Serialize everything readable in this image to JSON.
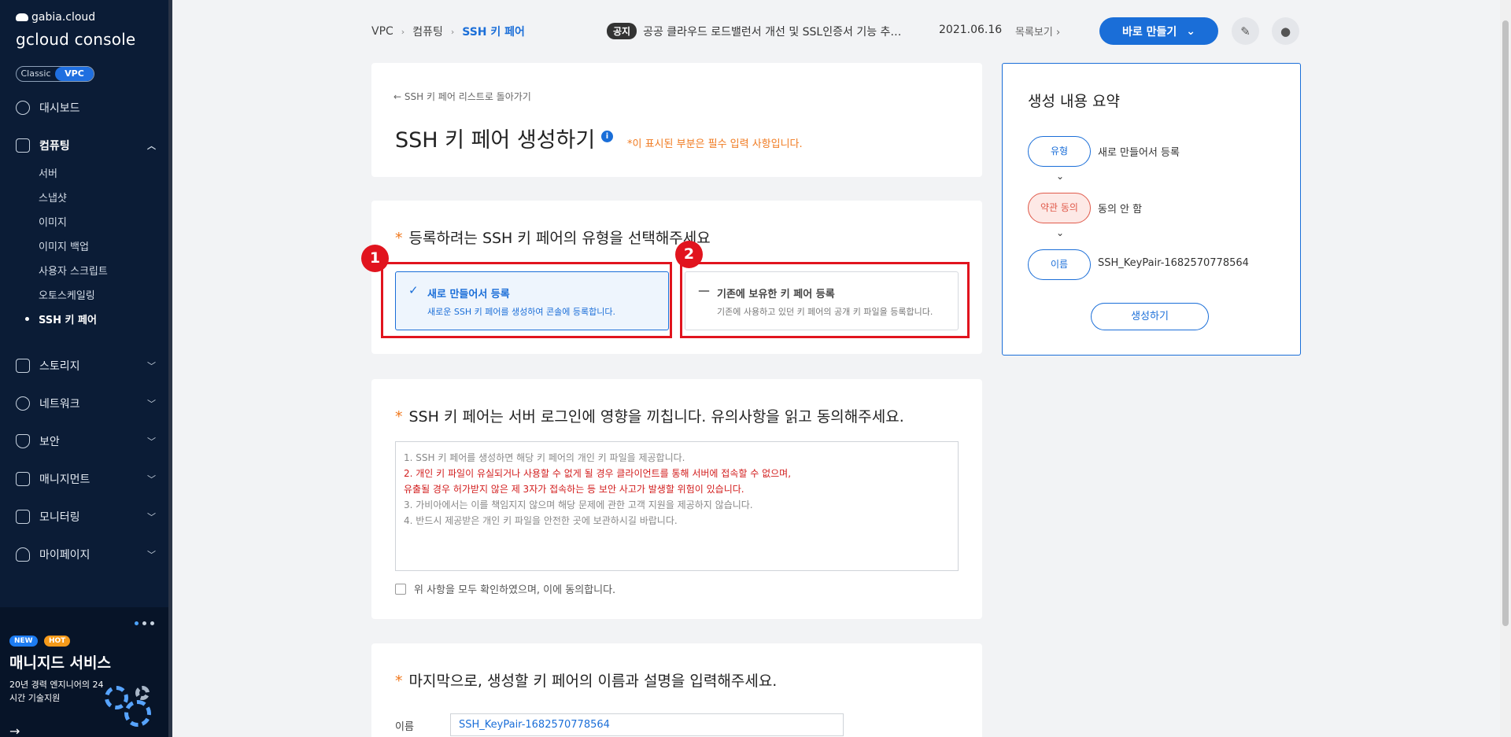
{
  "sidebar": {
    "logo_top": "gabia.cloud",
    "logo_main": "gcloud console",
    "mode": {
      "classic": "Classic",
      "vpc": "VPC"
    },
    "items": [
      {
        "label": "대시보드"
      },
      {
        "label": "컴퓨팅",
        "expanded": true
      },
      {
        "label": "스토리지"
      },
      {
        "label": "네트워크"
      },
      {
        "label": "보안"
      },
      {
        "label": "매니지먼트"
      },
      {
        "label": "모니터링"
      },
      {
        "label": "마이페이지"
      }
    ],
    "sub_items": [
      "서버",
      "스냅샷",
      "이미지",
      "이미지 백업",
      "사용자 스크립트",
      "오토스케일링",
      "SSH 키 페어"
    ],
    "promo": {
      "badge_new": "NEW",
      "badge_hot": "HOT",
      "title": "매니지드 서비스",
      "subtitle": "20년 경력 엔지니어의 24시간 기술지원"
    }
  },
  "topbar": {
    "breadcrumb": [
      "VPC",
      "컴퓨팅",
      "SSH 키 페어"
    ],
    "notice_tag": "공지",
    "notice_text": "공공 클라우드 로드밸런서 개선 및 SSL인증서 기능 추…",
    "notice_date": "2021.06.16",
    "notice_more": "목록보기",
    "make_button": "바로 만들기"
  },
  "header": {
    "back_link": "SSH 키 페어 리스트로 돌아가기",
    "title": "SSH 키 페어 생성하기",
    "required_note": "*이 표시된 부분은 필수 입력 사항입니다."
  },
  "type_section": {
    "title": "등록하려는 SSH 키 페어의 유형을 선택해주세요",
    "options": [
      {
        "title": "새로 만들어서 등록",
        "desc": "새로운 SSH 키 페어를 생성하여 콘솔에 등록합니다.",
        "selected": true,
        "marker": "1"
      },
      {
        "title": "기존에 보유한 키 페어 등록",
        "desc": "기존에 사용하고 있던 키 페어의 공개 키 파일을 등록합니다.",
        "selected": false,
        "marker": "2"
      }
    ]
  },
  "terms_section": {
    "title": "SSH 키 페어는 서버 로그인에 영향을 끼칩니다. 유의사항을 읽고 동의해주세요.",
    "lines": [
      "1. SSH 키 페어를 생성하면 해당 키 페어의 개인 키 파일을 제공합니다.",
      "2. 개인 키 파일이 유실되거나 사용할 수 없게 될 경우 클라이언트를 통해 서버에 접속할 수 없으며,",
      "유출될 경우 허가받지 않은 제 3자가 접속하는 등 보안 사고가 발생할 위험이 있습니다.",
      "3. 가비아에서는 이를 책임지지 않으며 해당 문제에 관한 고객 지원을 제공하지 않습니다.",
      "4. 반드시 제공받은 개인 키 파일을 안전한 곳에 보관하시길 바랍니다."
    ],
    "agree_label": "위 사항을 모두 확인하였으며, 이에 동의합니다."
  },
  "name_section": {
    "title": "마지막으로, 생성할 키 페어의 이름과 설명을 입력해주세요.",
    "name_label": "이름",
    "name_value": "SSH_KeyPair-1682570778564"
  },
  "summary": {
    "title": "생성 내용 요약",
    "rows": [
      {
        "pill": "유형",
        "value": "새로 만들어서 등록"
      },
      {
        "pill": "약관 동의",
        "value": "동의 안 함"
      },
      {
        "pill": "이름",
        "value": "SSH_KeyPair-1682570778564"
      }
    ],
    "create_button": "생성하기"
  },
  "colors": {
    "brand": "#1a6ed8",
    "sidebar_bg": "#0b1c36",
    "highlight": "#e1141e",
    "required": "#f07a20"
  }
}
